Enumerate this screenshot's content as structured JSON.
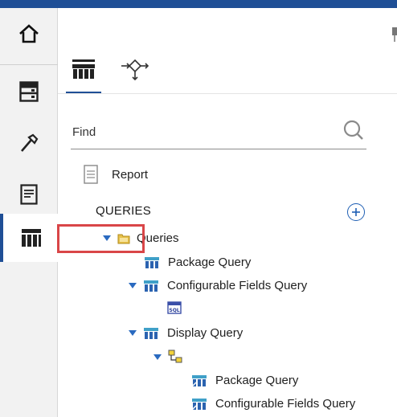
{
  "rail": {
    "items": [
      {
        "icon": "home-icon"
      },
      {
        "icon": "data-server-icon"
      },
      {
        "icon": "hammer-icon"
      },
      {
        "icon": "report-page-icon"
      },
      {
        "icon": "table-icon",
        "active": true
      }
    ]
  },
  "tabs": [
    {
      "icon": "queries-table-icon",
      "active": true
    },
    {
      "icon": "query-flow-icon"
    }
  ],
  "search": {
    "placeholder": "Find"
  },
  "tree": {
    "report_label": "Report",
    "section_label": "QUERIES",
    "items": [
      {
        "label": "Queries"
      },
      {
        "label": "Package Query"
      },
      {
        "label": "Configurable Fields Query"
      },
      {
        "label": "Display Query"
      },
      {
        "label": "Package Query"
      },
      {
        "label": "Configurable Fields Query"
      }
    ],
    "sql_badge": "SQL"
  },
  "colors": {
    "accent": "#1f4f96",
    "highlight": "#d94648",
    "caret": "#2a6ac0"
  }
}
